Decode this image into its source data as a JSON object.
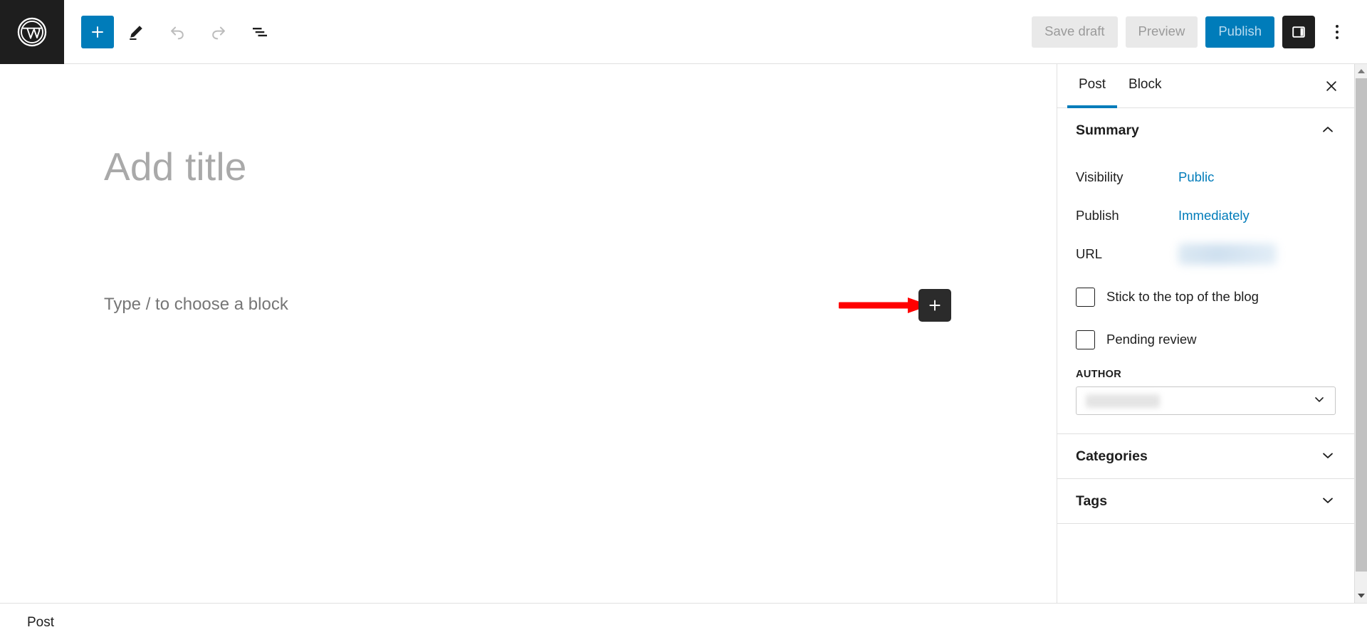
{
  "header": {
    "logo_icon": "wordpress-logo-icon",
    "tools": [
      {
        "name": "add-block",
        "icon": "plus-icon",
        "label": "Add block",
        "state": "primary"
      },
      {
        "name": "edit-tool",
        "icon": "pencil-icon",
        "label": "Tools",
        "state": "default"
      },
      {
        "name": "undo",
        "icon": "undo-arrow-icon",
        "label": "Undo",
        "state": "disabled"
      },
      {
        "name": "redo",
        "icon": "redo-arrow-icon",
        "label": "Redo",
        "state": "disabled"
      },
      {
        "name": "list-view",
        "icon": "document-outline-icon",
        "label": "Document overview",
        "state": "default"
      }
    ],
    "save_draft_label": "Save draft",
    "preview_label": "Preview",
    "publish_label": "Publish",
    "sidebar_toggle_icon": "settings-panel-icon",
    "options_icon": "kebab-menu-icon"
  },
  "editor": {
    "title_placeholder": "Add title",
    "block_placeholder": "Type / to choose a block",
    "inserter_icon": "plus-icon",
    "annotation": {
      "type": "arrow",
      "color": "#FF0000",
      "points_to": "block-inserter-button"
    }
  },
  "sidebar": {
    "tabs": [
      {
        "label": "Post",
        "active": true
      },
      {
        "label": "Block",
        "active": false
      }
    ],
    "close_icon": "close-icon",
    "panels": [
      {
        "title": "Summary",
        "expanded": true,
        "chevron": "chevron-up-icon"
      },
      {
        "title": "Categories",
        "expanded": false,
        "chevron": "chevron-down-icon"
      },
      {
        "title": "Tags",
        "expanded": false,
        "chevron": "chevron-down-icon"
      }
    ],
    "summary": {
      "visibility_label": "Visibility",
      "visibility_value": "Public",
      "publish_label": "Publish",
      "publish_value": "Immediately",
      "url_label": "URL",
      "url_value": "",
      "url_redacted": true,
      "sticky_label": "Stick to the top of the blog",
      "sticky_checked": false,
      "pending_label": "Pending review",
      "pending_checked": false,
      "author_label": "AUTHOR",
      "author_value": "",
      "author_redacted": true,
      "author_chevron": "chevron-down-icon"
    }
  },
  "status_bar": {
    "label": "Post"
  },
  "colors": {
    "accent_blue": "#007cba",
    "link_blue": "#007cba",
    "dark": "#1e1e1e",
    "annotation_red": "#FF0000",
    "muted_gray": "#9a9a9a"
  }
}
